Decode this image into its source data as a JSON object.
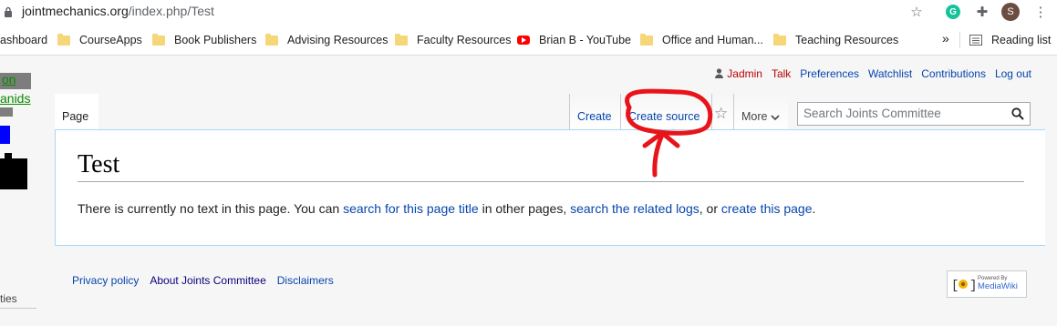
{
  "address_bar": {
    "domain": "jointmechanics.org",
    "path": "/index.php/Test",
    "profile_initial": "S"
  },
  "bookmarks": [
    {
      "label": "ashboard",
      "icon": "none"
    },
    {
      "label": "CourseApps",
      "icon": "folder-icon"
    },
    {
      "label": "Book Publishers",
      "icon": "folder-icon"
    },
    {
      "label": "Advising Resources",
      "icon": "folder-icon"
    },
    {
      "label": "Faculty Resources",
      "icon": "folder-icon"
    },
    {
      "label": "Brian B - YouTube",
      "icon": "youtube-icon"
    },
    {
      "label": "Office and Human...",
      "icon": "folder-icon"
    },
    {
      "label": "Teaching Resources",
      "icon": "folder-icon"
    }
  ],
  "bookmarks_more": "»",
  "reading_list": "Reading list",
  "logo_fragment": {
    "line1": "on",
    "line2": "anids"
  },
  "personal_tools": {
    "user": "Jadmin",
    "talk": "Talk",
    "preferences": "Preferences",
    "watchlist": "Watchlist",
    "contributions": "Contributions",
    "logout": "Log out"
  },
  "tabs": {
    "page": "Page",
    "create": "Create",
    "create_source": "Create source",
    "more": "More"
  },
  "search": {
    "placeholder": "Search Joints Committee"
  },
  "content": {
    "title": "Test",
    "text_1": "There is currently no text in this page. You can ",
    "link_1": "search for this page title",
    "text_2": " in other pages, ",
    "link_2": "search the related logs",
    "text_3": ", or ",
    "link_3": "create this page",
    "text_4": "."
  },
  "footer": {
    "privacy": "Privacy policy",
    "about": "About Joints Committee",
    "disclaimers": "Disclaimers"
  },
  "sidebar_fragment": "ties",
  "mediawiki_badge": {
    "line1": "Powered By",
    "line2": "MediaWiki"
  },
  "colors": {
    "link": "#0645ad",
    "redlink": "#ba0000",
    "annotation": "#e8141a"
  }
}
